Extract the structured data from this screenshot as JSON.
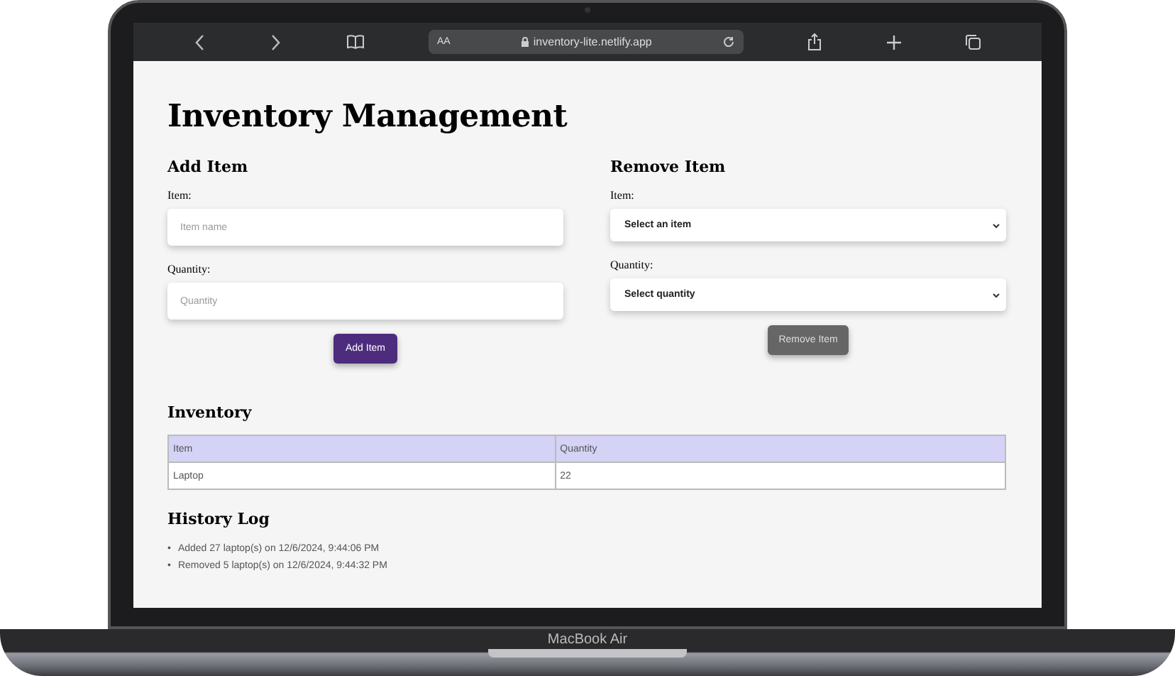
{
  "browser": {
    "text_size_button": "AA",
    "url": "inventory-lite.netlify.app"
  },
  "page": {
    "title": "Inventory Management",
    "add_item": {
      "heading": "Add Item",
      "fields": [
        {
          "label": "Item:",
          "placeholder": "Item name"
        },
        {
          "label": "Quantity:",
          "placeholder": "Quantity"
        }
      ],
      "button": {
        "label": "Add Item",
        "disabled": false
      }
    },
    "remove_item": {
      "heading": "Remove Item",
      "fields": [
        {
          "label": "Item:",
          "value": "Select an item"
        },
        {
          "label": "Quantity:",
          "value": "Select quantity"
        }
      ],
      "button": {
        "label": "Remove Item",
        "disabled": true
      }
    },
    "inventory": {
      "heading": "Inventory",
      "columns": [
        "Item",
        "Quantity"
      ],
      "rows": [
        [
          "Laptop",
          "22"
        ]
      ]
    },
    "history_log": {
      "heading": "History Log",
      "entries": [
        {
          "marker": "•",
          "text": "Added 27 laptop(s) on 12/6/2024, 9:44:06 PM"
        },
        {
          "marker": "•",
          "text": "Removed 5 laptop(s) on 12/6/2024, 9:44:32 PM"
        }
      ]
    }
  },
  "device_label": "MacBook Air"
}
